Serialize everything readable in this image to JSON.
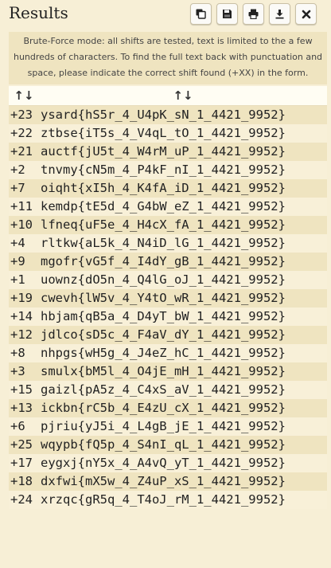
{
  "header": {
    "title": "Results",
    "toolbar": [
      {
        "icon": "copy-icon"
      },
      {
        "icon": "save-icon"
      },
      {
        "icon": "print-icon"
      },
      {
        "icon": "download-icon"
      },
      {
        "icon": "close-icon"
      }
    ]
  },
  "notice": "Brute-Force mode: all shifts are tested, text is limited to the a few hundreds of characters. To find the full text back with punctuation and space, please indicate the correct shift found (+XX) in the form.",
  "table": {
    "headers": [
      "↑↓",
      "↑↓"
    ],
    "rows": [
      {
        "shift": "+23",
        "text": "ysard{hS5r_4_U4pK_sN_1_4421_9952}"
      },
      {
        "shift": "+22",
        "text": "ztbse{iT5s_4_V4qL_tO_1_4421_9952}"
      },
      {
        "shift": "+21",
        "text": "auctf{jU5t_4_W4rM_uP_1_4421_9952}"
      },
      {
        "shift": "+2",
        "text": "tnvmy{cN5m_4_P4kF_nI_1_4421_9952}"
      },
      {
        "shift": "+7",
        "text": "oiqht{xI5h_4_K4fA_iD_1_4421_9952}"
      },
      {
        "shift": "+11",
        "text": "kemdp{tE5d_4_G4bW_eZ_1_4421_9952}"
      },
      {
        "shift": "+10",
        "text": "lfneq{uF5e_4_H4cX_fA_1_4421_9952}"
      },
      {
        "shift": "+4",
        "text": "rltkw{aL5k_4_N4iD_lG_1_4421_9952}"
      },
      {
        "shift": "+9",
        "text": "mgofr{vG5f_4_I4dY_gB_1_4421_9952}"
      },
      {
        "shift": "+1",
        "text": "uownz{dO5n_4_Q4lG_oJ_1_4421_9952}"
      },
      {
        "shift": "+19",
        "text": "cwevh{lW5v_4_Y4tO_wR_1_4421_9952}"
      },
      {
        "shift": "+14",
        "text": "hbjam{qB5a_4_D4yT_bW_1_4421_9952}"
      },
      {
        "shift": "+12",
        "text": "jdlco{sD5c_4_F4aV_dY_1_4421_9952}"
      },
      {
        "shift": "+8",
        "text": "nhpgs{wH5g_4_J4eZ_hC_1_4421_9952}"
      },
      {
        "shift": "+3",
        "text": "smulx{bM5l_4_O4jE_mH_1_4421_9952}"
      },
      {
        "shift": "+15",
        "text": "gaizl{pA5z_4_C4xS_aV_1_4421_9952}"
      },
      {
        "shift": "+13",
        "text": "ickbn{rC5b_4_E4zU_cX_1_4421_9952}"
      },
      {
        "shift": "+6",
        "text": "pjriu{yJ5i_4_L4gB_jE_1_4421_9952}"
      },
      {
        "shift": "+25",
        "text": "wqypb{fQ5p_4_S4nI_qL_1_4421_9952}"
      },
      {
        "shift": "+17",
        "text": "eygxj{nY5x_4_A4vQ_yT_1_4421_9952}"
      },
      {
        "shift": "+18",
        "text": "dxfwi{mX5w_4_Z4uP_xS_1_4421_9952}"
      },
      {
        "shift": "+24",
        "text": "xrzqc{gR5q_4_T4oJ_rM_1_4421_9952}"
      }
    ]
  }
}
